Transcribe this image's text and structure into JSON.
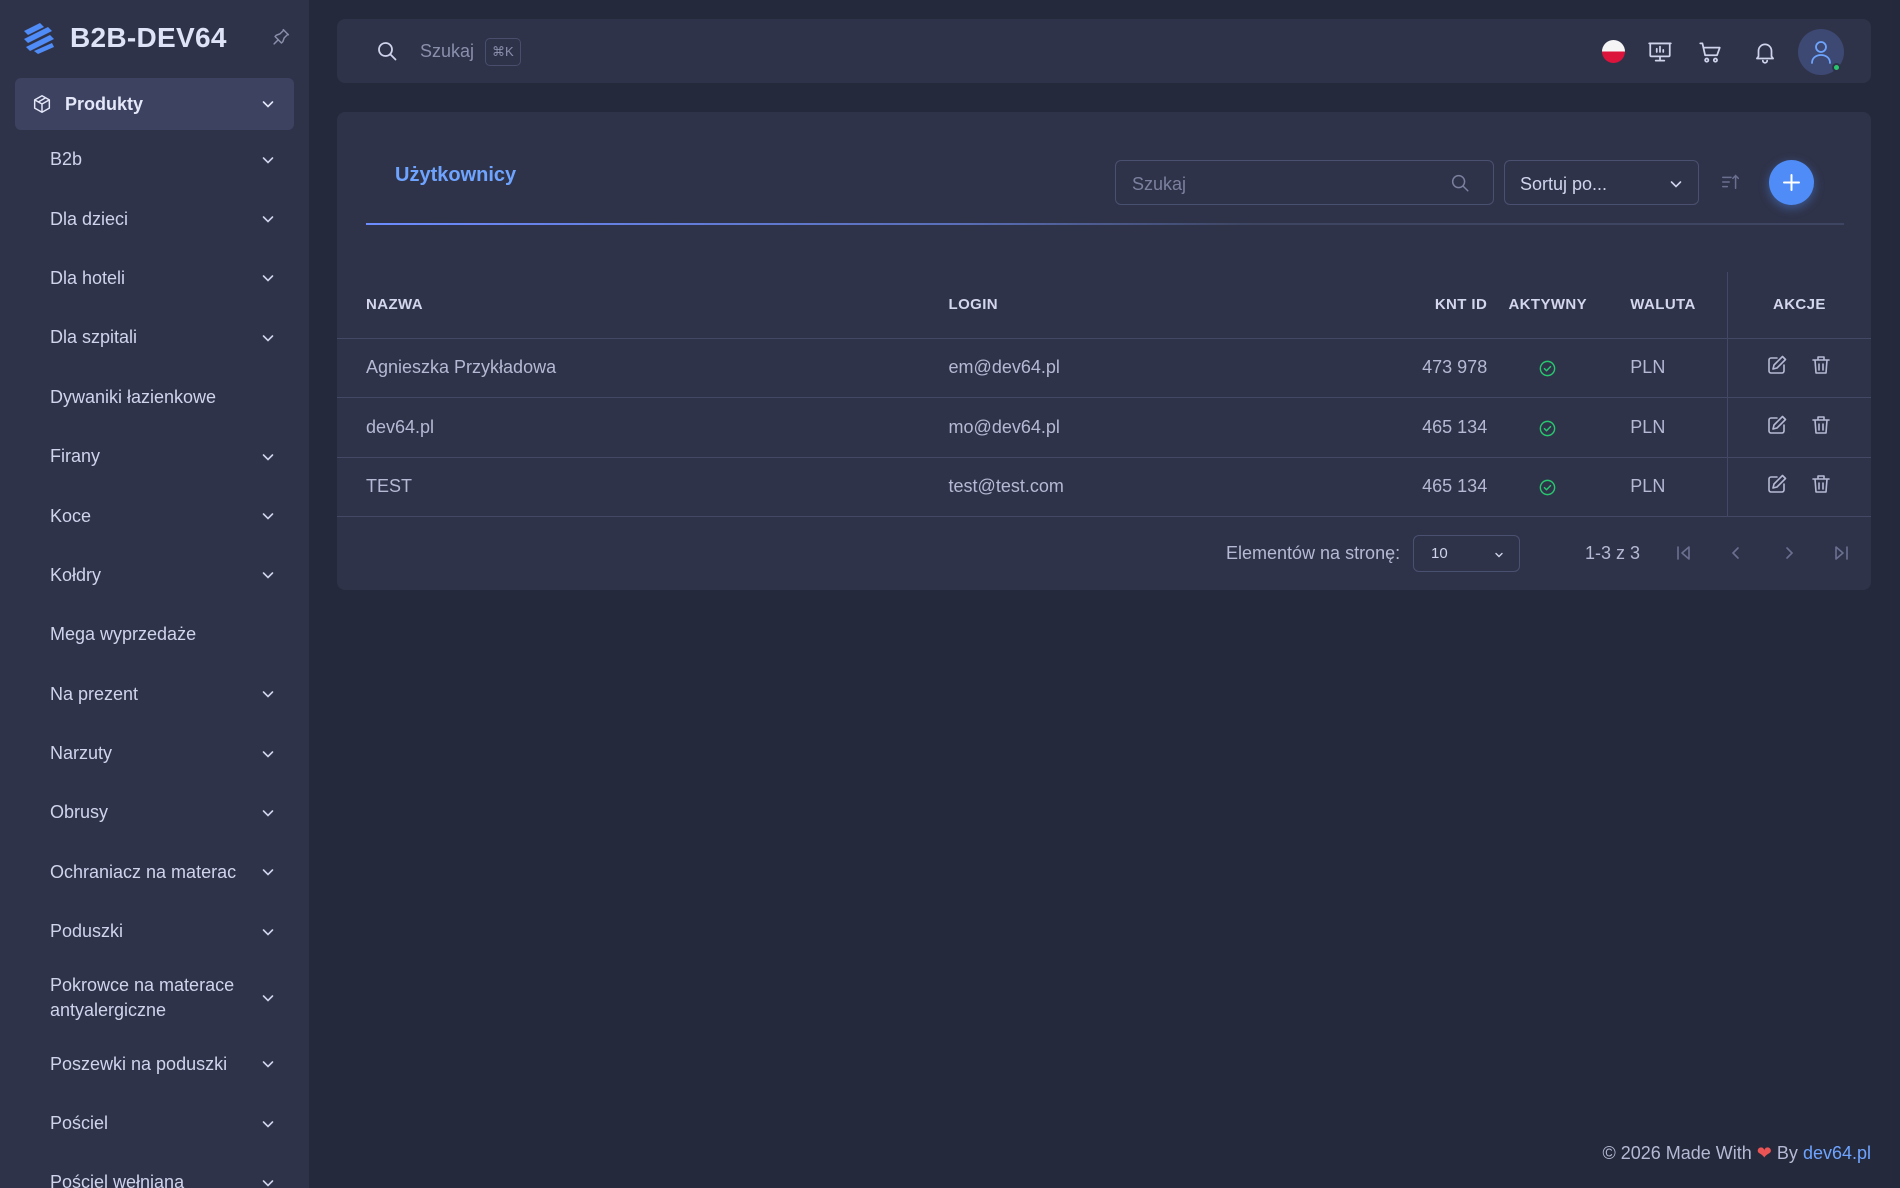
{
  "brand": {
    "name": "B2B-DEV64"
  },
  "sidebar": {
    "top": {
      "label": "Produkty"
    },
    "items": [
      {
        "label": "B2b",
        "expandable": true
      },
      {
        "label": "Dla dzieci",
        "expandable": true
      },
      {
        "label": "Dla hoteli",
        "expandable": true
      },
      {
        "label": "Dla szpitali",
        "expandable": true
      },
      {
        "label": "Dywaniki łazienkowe",
        "expandable": false
      },
      {
        "label": "Firany",
        "expandable": true
      },
      {
        "label": "Koce",
        "expandable": true
      },
      {
        "label": "Kołdry",
        "expandable": true
      },
      {
        "label": "Mega wyprzedaże",
        "expandable": false
      },
      {
        "label": "Na prezent",
        "expandable": true
      },
      {
        "label": "Narzuty",
        "expandable": true
      },
      {
        "label": "Obrusy",
        "expandable": true
      },
      {
        "label": "Ochraniacz na materac",
        "expandable": true
      },
      {
        "label": "Poduszki",
        "expandable": true
      },
      {
        "label": "Pokrowce na materace antyalergiczne",
        "expandable": true
      },
      {
        "label": "Poszewki na poduszki",
        "expandable": true
      },
      {
        "label": "Pościel",
        "expandable": true
      },
      {
        "label": "Pościel wełniana",
        "expandable": true
      }
    ]
  },
  "topbar": {
    "search_label": "Szukaj",
    "shortcut": "⌘K"
  },
  "card": {
    "title": "Użytkownicy",
    "search_placeholder": "Szukaj",
    "sort_value": "Sortuj po..."
  },
  "table": {
    "headers": {
      "name": "NAZWA",
      "login": "LOGIN",
      "knt_id": "KNT ID",
      "active": "AKTYWNY",
      "currency": "WALUTA",
      "actions": "AKCJE"
    },
    "rows": [
      {
        "name": "Agnieszka Przykładowa",
        "login": "em@dev64.pl",
        "knt_id": "473 978",
        "active": true,
        "currency": "PLN"
      },
      {
        "name": "dev64.pl",
        "login": "mo@dev64.pl",
        "knt_id": "465 134",
        "active": true,
        "currency": "PLN"
      },
      {
        "name": "TEST",
        "login": "test@test.com",
        "knt_id": "465 134",
        "active": true,
        "currency": "PLN"
      }
    ]
  },
  "pager": {
    "label": "Elementów na stronę:",
    "page_size": "10",
    "range": "1-3 z 3"
  },
  "footer": {
    "prefix": "© 2026 Made With",
    "by": "By",
    "link": "dev64.pl"
  },
  "colors": {
    "accent": "#4f8cf7",
    "success": "#28c76f",
    "heart": "#ea5455"
  }
}
